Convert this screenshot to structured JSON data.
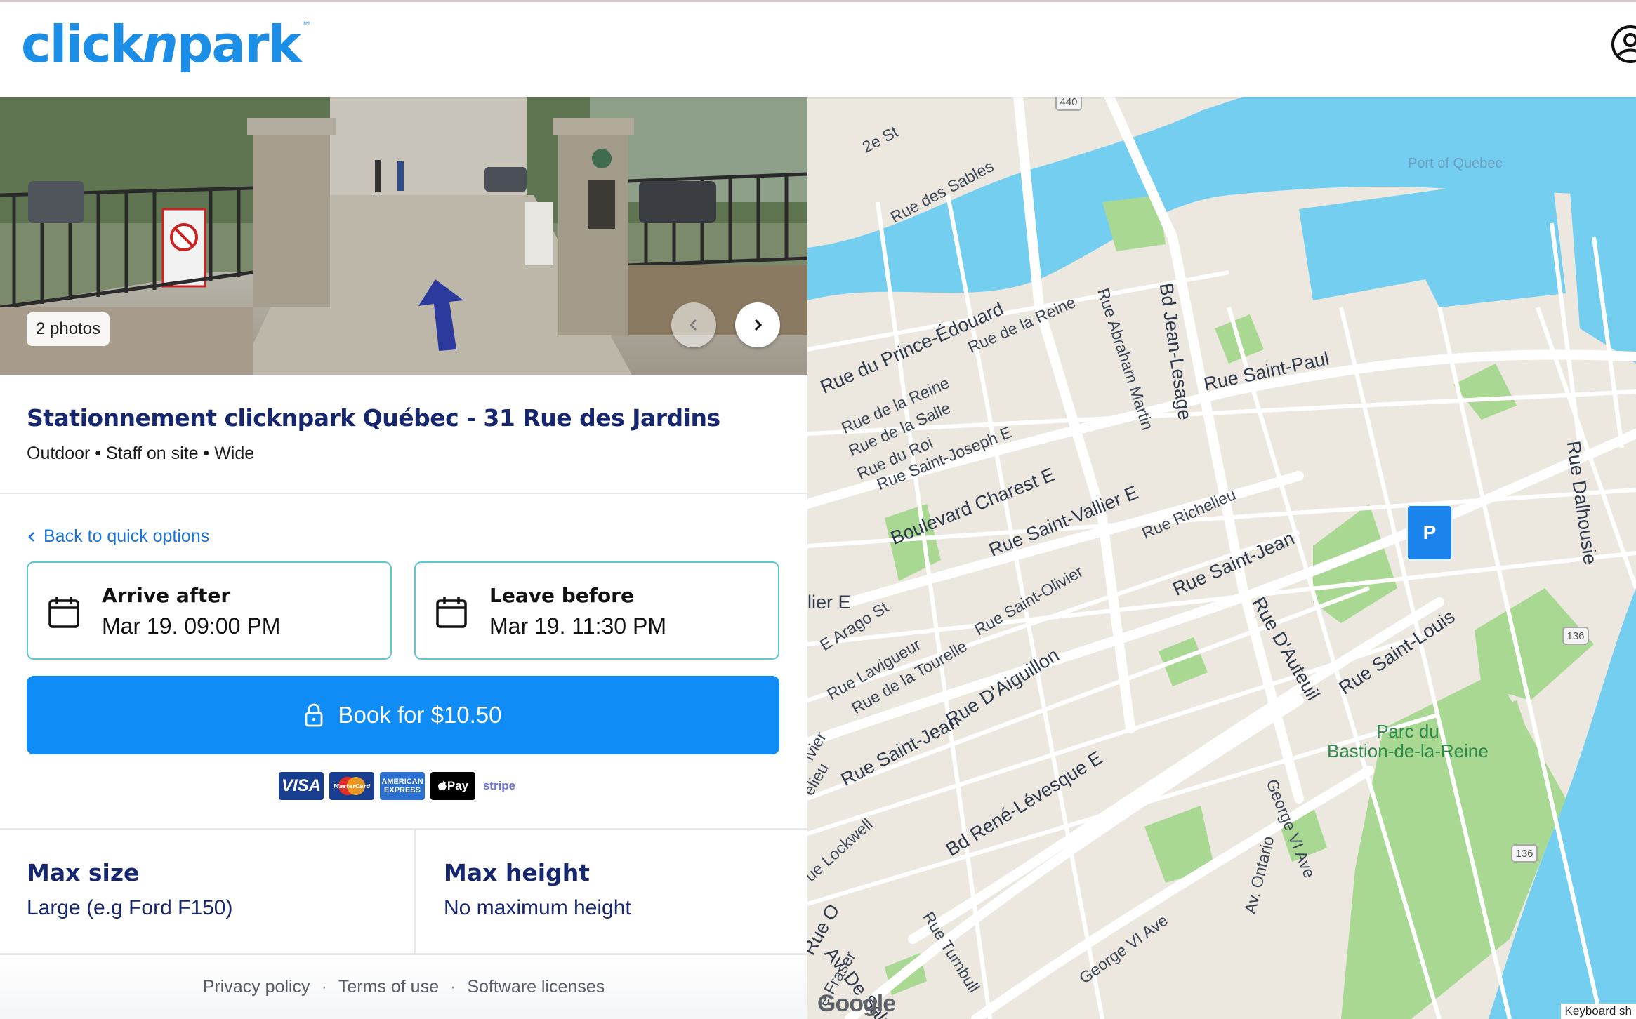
{
  "header": {
    "logo_pre": "click",
    "logo_n": "n",
    "logo_post": "park",
    "logo_tm": "™",
    "account_icon": "account-circle-icon"
  },
  "photos": {
    "count_label": "2 photos",
    "prev_icon": "chevron-left-icon",
    "next_icon": "chevron-right-icon"
  },
  "listing": {
    "title": "Stationnement clicknpark Québec - 31 Rue des Jardins",
    "subtitle": "Outdoor • Staff on site • Wide"
  },
  "booking": {
    "back_label": "Back to quick options",
    "arrive_label": "Arrive after",
    "arrive_value": "Mar 19. 09:00 PM",
    "leave_label": "Leave before",
    "leave_value": "Mar 19. 11:30 PM",
    "book_label": "Book for $10.50",
    "payment_methods": [
      "VISA",
      "MasterCard",
      "AMERICAN EXPRESS",
      "Pay",
      "stripe"
    ]
  },
  "specs": {
    "size_heading": "Max size",
    "size_value": "Large (e.g Ford F150)",
    "height_heading": "Max height",
    "height_value": "No maximum height"
  },
  "footer": {
    "privacy": "Privacy policy",
    "terms": "Terms of use",
    "licenses": "Software licenses",
    "sep": "·"
  },
  "map": {
    "pin_label": "P",
    "google_label": "Google",
    "keyboard_label": "Keyboard sh",
    "shields": [
      "440",
      "136",
      "136"
    ],
    "labels": {
      "port": "Port of Quebec",
      "second_st": "2e St",
      "sables": "Rue des Sables",
      "jean_lesage": "Bd Jean-Lesage",
      "abraham": "Rue Abraham Martin",
      "prince": "Rue du Prince-Édouard",
      "reine1": "Rue de la Reine",
      "reine2": "Rue de la Reine",
      "salle": "Rue de la Salle",
      "roi": "Rue du Roi",
      "saint_paul": "Rue Saint-Paul",
      "dalhousie": "Rue Dalhousie",
      "joseph": "Rue Saint-Joseph E",
      "charest": "Boulevard Charest E",
      "vallier": "Rue Saint-Vallier E",
      "richelieu": "Rue Richelieu",
      "saint_jean1": "Rue Saint-Jean",
      "lier": "lier E",
      "arago": "E Arago St",
      "olivier": "Rue Saint-Olivier",
      "lavigueur": "Rue Lavigueur",
      "tourelle": "Rue de la Tourelle",
      "auteuil": "Rue D'Auteuil",
      "saint_louis": "Rue Saint-Louis",
      "aiguillon": "Rue D'Aiguillon",
      "saint_jean2": "Rue Saint-Jean",
      "levesque": "Bd René-Lévesque E",
      "bastion": "Parc du\nBastion-de-la-Reine",
      "george1": "George VI Ave",
      "ontario": "Av. Ontario",
      "george2": "George VI Ave",
      "lockwell": "ue Lockwell",
      "turnbull": "Rue Turnbull",
      "salaberry": "Av. De Salaberry",
      "o": "Rue O",
      "fraser": "e Fraser",
      "vivier": "ivier",
      "lieu": "elieu"
    }
  }
}
